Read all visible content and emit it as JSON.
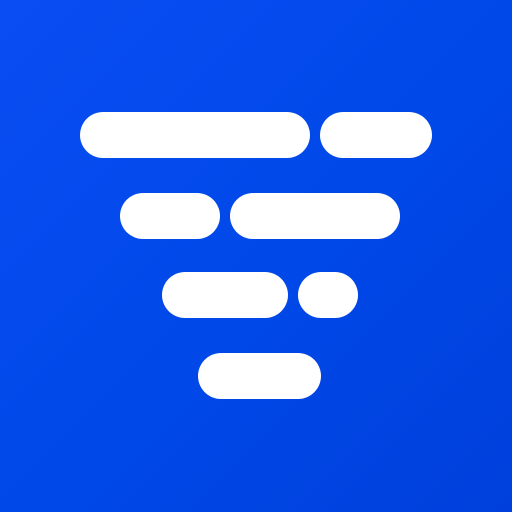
{
  "app_icon": {
    "background_colors": [
      "#0a4df3",
      "#003fdc"
    ],
    "mark_color": "#ffffff",
    "logo_name": "funnel-of-rounded-bars-logo"
  }
}
